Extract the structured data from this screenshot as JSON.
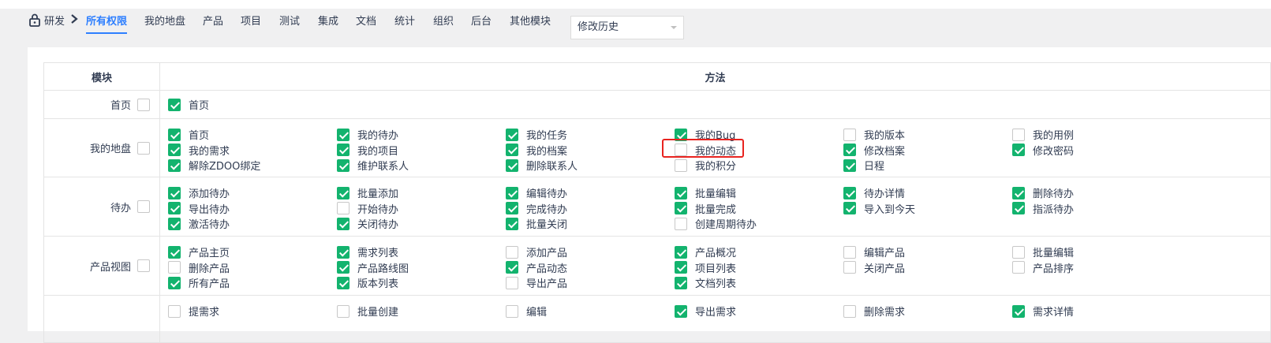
{
  "nav": {
    "brand": "研发",
    "tabs": [
      "所有权限",
      "我的地盘",
      "产品",
      "项目",
      "测试",
      "集成",
      "文档",
      "统计",
      "组织",
      "后台",
      "其他模块"
    ],
    "active_tab": "所有权限",
    "history_select": "修改历史"
  },
  "table": {
    "col_module": "模块",
    "col_method": "方法",
    "rows": [
      {
        "module": "首页",
        "module_checked": false,
        "methods": [
          {
            "label": "首页",
            "checked": true
          }
        ]
      },
      {
        "module": "我的地盘",
        "module_checked": false,
        "methods": [
          {
            "label": "首页",
            "checked": true
          },
          {
            "label": "我的待办",
            "checked": true
          },
          {
            "label": "我的任务",
            "checked": true
          },
          {
            "label": "我的Bug",
            "checked": true
          },
          {
            "label": "我的版本",
            "checked": false
          },
          {
            "label": "我的用例",
            "checked": false
          },
          {
            "label": "我的需求",
            "checked": true
          },
          {
            "label": "我的项目",
            "checked": true
          },
          {
            "label": "我的档案",
            "checked": true
          },
          {
            "label": "我的动态",
            "checked": false
          },
          {
            "label": "修改档案",
            "checked": true
          },
          {
            "label": "修改密码",
            "checked": true
          },
          {
            "label": "解除ZDOO绑定",
            "checked": true
          },
          {
            "label": "维护联系人",
            "checked": true
          },
          {
            "label": "删除联系人",
            "checked": true
          },
          {
            "label": "我的积分",
            "checked": false
          },
          {
            "label": "日程",
            "checked": true
          }
        ]
      },
      {
        "module": "待办",
        "module_checked": false,
        "methods": [
          {
            "label": "添加待办",
            "checked": true
          },
          {
            "label": "批量添加",
            "checked": true
          },
          {
            "label": "编辑待办",
            "checked": true
          },
          {
            "label": "批量编辑",
            "checked": true
          },
          {
            "label": "待办详情",
            "checked": true
          },
          {
            "label": "删除待办",
            "checked": true
          },
          {
            "label": "导出待办",
            "checked": true
          },
          {
            "label": "开始待办",
            "checked": false
          },
          {
            "label": "完成待办",
            "checked": true
          },
          {
            "label": "批量完成",
            "checked": true
          },
          {
            "label": "导入到今天",
            "checked": true
          },
          {
            "label": "指派待办",
            "checked": true
          },
          {
            "label": "激活待办",
            "checked": true
          },
          {
            "label": "关闭待办",
            "checked": true
          },
          {
            "label": "批量关闭",
            "checked": true
          },
          {
            "label": "创建周期待办",
            "checked": false
          }
        ]
      },
      {
        "module": "产品视图",
        "module_checked": false,
        "methods": [
          {
            "label": "产品主页",
            "checked": true
          },
          {
            "label": "需求列表",
            "checked": true
          },
          {
            "label": "添加产品",
            "checked": false
          },
          {
            "label": "产品概况",
            "checked": true
          },
          {
            "label": "编辑产品",
            "checked": false
          },
          {
            "label": "批量编辑",
            "checked": false
          },
          {
            "label": "删除产品",
            "checked": false
          },
          {
            "label": "产品路线图",
            "checked": true
          },
          {
            "label": "产品动态",
            "checked": true
          },
          {
            "label": "项目列表",
            "checked": true
          },
          {
            "label": "关闭产品",
            "checked": false
          },
          {
            "label": "产品排序",
            "checked": false
          },
          {
            "label": "所有产品",
            "checked": true
          },
          {
            "label": "版本列表",
            "checked": true
          },
          {
            "label": "导出产品",
            "checked": false
          },
          {
            "label": "文档列表",
            "checked": true
          }
        ]
      },
      {
        "module": "",
        "module_checked": false,
        "methods": [
          {
            "label": "提需求",
            "checked": false
          },
          {
            "label": "批量创建",
            "checked": false
          },
          {
            "label": "编辑",
            "checked": false
          },
          {
            "label": "导出需求",
            "checked": true
          },
          {
            "label": "删除需求",
            "checked": false
          },
          {
            "label": "需求详情",
            "checked": true
          }
        ]
      }
    ]
  },
  "colors": {
    "accent": "#2e7fff",
    "checked": "#13b36e",
    "highlight": "#e8231f"
  }
}
